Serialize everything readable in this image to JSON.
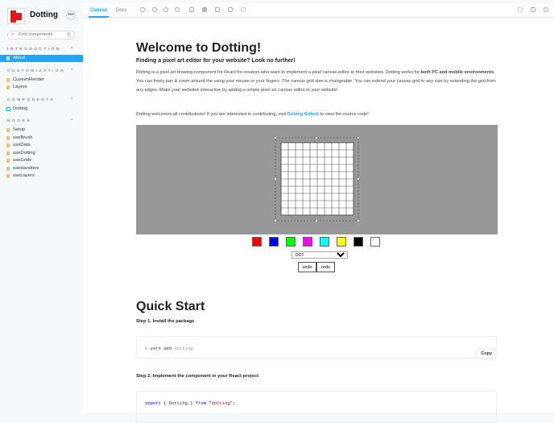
{
  "sidebar": {
    "brand": "Dotting",
    "search_placeholder": "Find components",
    "search_key": "/",
    "sections": [
      {
        "title": "INTRODUCTION",
        "items": [
          "About"
        ]
      },
      {
        "title": "CUSTOMIZATION",
        "items": [
          "CustomRender",
          "Layers"
        ]
      },
      {
        "title": "COMPONENTS",
        "items": [
          "Dotting"
        ]
      },
      {
        "title": "HOOKS",
        "items": [
          "Setup",
          "useBrush",
          "useData",
          "useDotting",
          "useGrids",
          "useHandlers",
          "useLayers"
        ]
      }
    ],
    "selected": "About"
  },
  "toolbar": {
    "tabs": [
      "Canvas",
      "Docs"
    ],
    "active_tab": "Canvas"
  },
  "doc": {
    "title": "Welcome to Dotting!",
    "subtitle": "Finding a pixel art editor for your website? Look no further!",
    "p1a": "Dotting is a pixel art drawing component for React for creators who want to implement a pixel canvas editor to their websites. Dotting works for ",
    "p1b": "both PC and mobile environments",
    "p1c": ". You can freely pan & zoom around the using your mouse or your fingers. The canvas grid size is changeable. You can extend your canvas grid to any size by extending the grid from any edges. Make your websites interactive by adding a simple pixel art canvas editor to your website!",
    "p2a": "Dotting welcomes all contributions! If you are interested in contributing, visit ",
    "p2link": "Dotting Github",
    "p2b": " to view the source code!",
    "colors": [
      "#ff0000",
      "#0000ff",
      "#00ff00",
      "#ff00ff",
      "#00ffff",
      "#ffff00",
      "#000000",
      "#ffffff"
    ],
    "brush_select": "DOT",
    "undo": "undo",
    "redo": "redo",
    "quick_start": "Quick Start",
    "step1": "Step 1. Install the package",
    "code1_prompt": "$",
    "code1_cmd": "yarn add",
    "code1_pkg": "dotting",
    "copy": "Copy",
    "step2": "Step 2. Implement the component in your React project",
    "code2_kw": "import",
    "code2_mid": "{ Dotting }",
    "code2_from": "from",
    "code2_str": "\"dotting\";"
  }
}
